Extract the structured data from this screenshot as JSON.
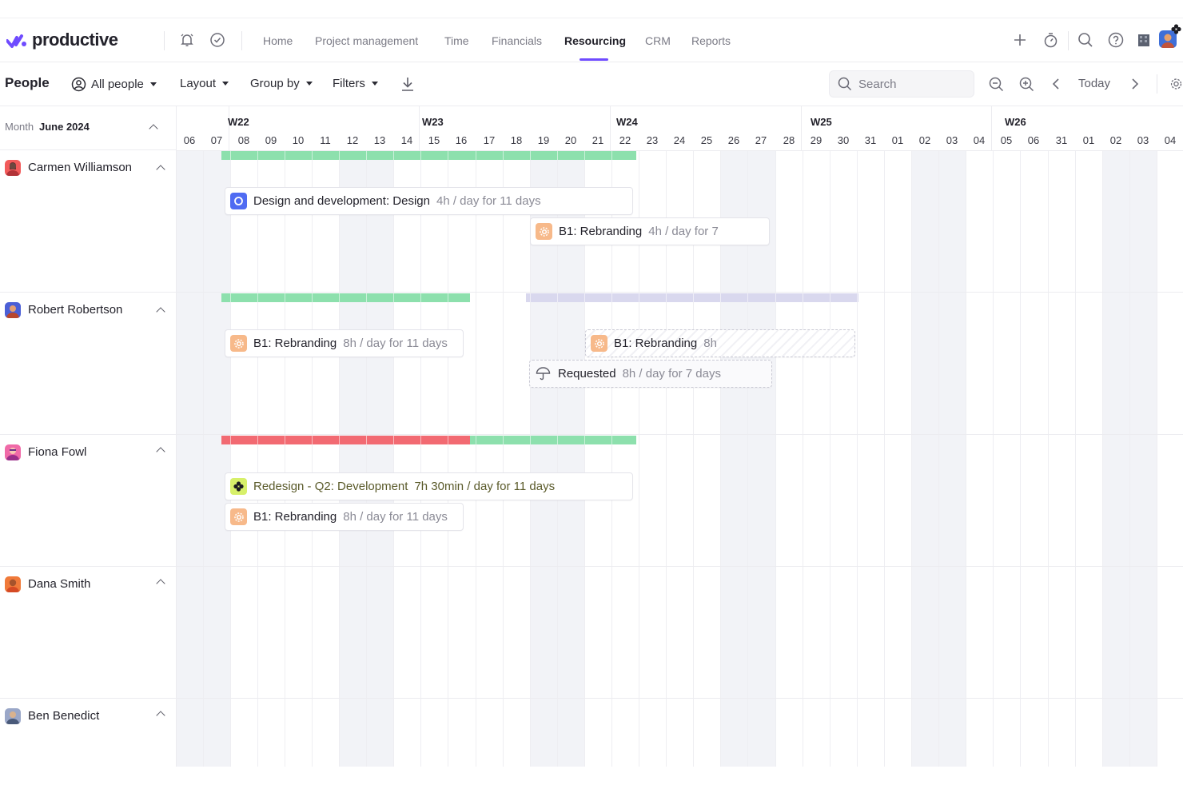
{
  "app": {
    "logo_text": "productive",
    "brand_color": "#6f4bff"
  },
  "nav": {
    "links": [
      "Home",
      "Project management",
      "Time",
      "Financials",
      "Resourcing",
      "CRM",
      "Reports"
    ],
    "active": "Resourcing",
    "icons": [
      "bell-icon",
      "check-circle-icon",
      "plus-icon",
      "timer-icon",
      "search-icon",
      "help-icon",
      "building-icon",
      "avatar"
    ]
  },
  "toolbar": {
    "title": "People",
    "all_people": "All people",
    "layout": "Layout",
    "group_by": "Group by",
    "filters": "Filters",
    "search_placeholder": "Search",
    "today": "Today"
  },
  "calendar": {
    "month_label": "Month",
    "month_value": "June 2024",
    "weeks": [
      "W22",
      "W23",
      "W24",
      "W25",
      "W26"
    ],
    "days": [
      "06",
      "07",
      "08",
      "09",
      "10",
      "11",
      "12",
      "13",
      "14",
      "15",
      "16",
      "17",
      "18",
      "19",
      "20",
      "21",
      "22",
      "23",
      "24",
      "25",
      "26",
      "27",
      "28",
      "29",
      "30",
      "31",
      "01",
      "02",
      "03",
      "04",
      "05",
      "06",
      "31",
      "01",
      "02",
      "03",
      "04"
    ]
  },
  "people": [
    {
      "name": "Carmen Williamson"
    },
    {
      "name": "Robert Robertson"
    },
    {
      "name": "Fiona Fowl"
    },
    {
      "name": "Dana Smith"
    },
    {
      "name": "Ben Benedict"
    }
  ],
  "bookings": {
    "carmen_1": {
      "title": "Design and development: Design",
      "sub": "4h / day for 11 days"
    },
    "carmen_2": {
      "title": "B1: Rebranding",
      "sub": "4h / day for 7"
    },
    "robert_1": {
      "title": "B1: Rebranding",
      "sub": "8h / day for 11 days"
    },
    "robert_2": {
      "title": "B1: Rebranding",
      "sub": "8h"
    },
    "robert_3": {
      "title": "Requested",
      "sub": "8h / day for 7 days"
    },
    "fiona_1": {
      "title": "Redesign - Q2: Development",
      "sub": "7h 30min / day for 11 days"
    },
    "fiona_2": {
      "title": "B1: Rebranding",
      "sub": "8h / day for 11 days"
    }
  },
  "colors": {
    "capacity_ok": "#8de0ad",
    "capacity_over": "#f26a72",
    "capacity_pending": "#d9d8ee",
    "weekend": "#f2f3f7",
    "rebranding_icon": "#f7b98a",
    "design_icon": "#4f6bf2",
    "redesign_icon": "#d7f06a"
  }
}
